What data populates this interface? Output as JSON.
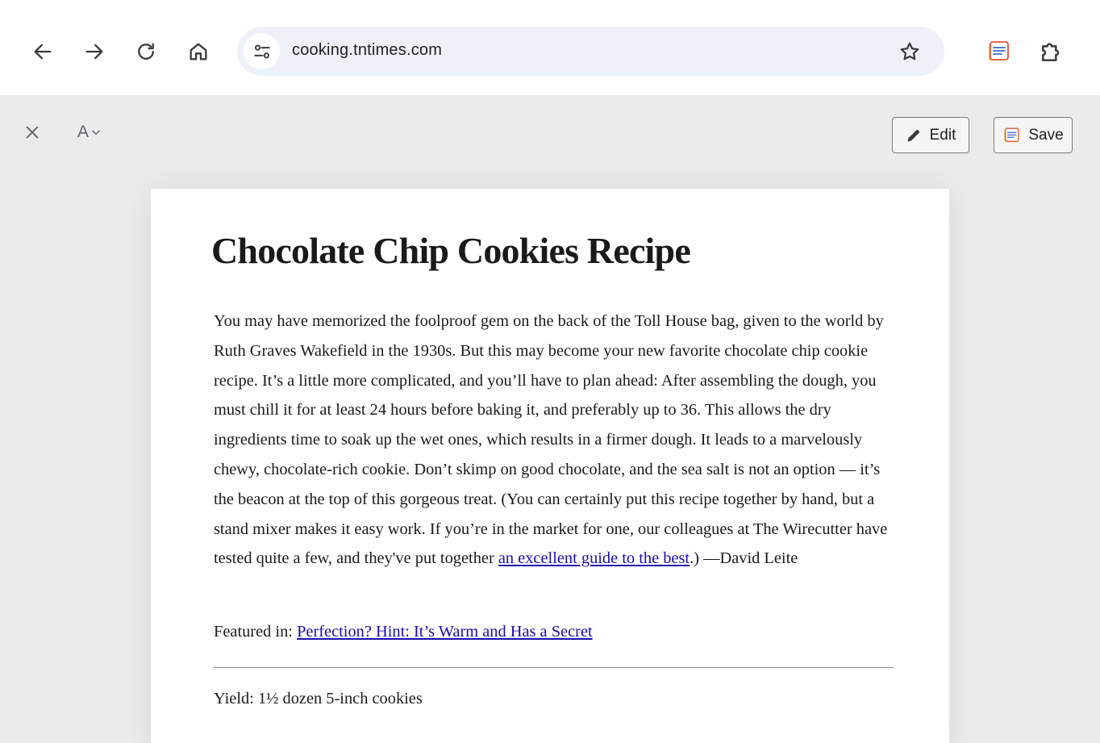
{
  "browser": {
    "url": "cooking.tntimes.com",
    "icons": {
      "back": "arrow-left-icon",
      "forward": "arrow-right-icon",
      "reload": "reload-icon",
      "home": "home-icon",
      "site_info": "tune-icon",
      "bookmark": "star-icon",
      "notes_extension": "notes-icon",
      "extensions": "puzzle-piece-icon"
    }
  },
  "reader_bar": {
    "font_label": "A",
    "edit_label": "Edit",
    "save_label": "Save"
  },
  "article": {
    "title": "Chocolate Chip Cookies Recipe",
    "intro": "You may have memorized the foolproof gem on the back of the Toll House bag, given to the world by Ruth Graves Wakefield in the 1930s. But this may become your new favorite chocolate chip cookie recipe. It’s a little more complicated, and you’ll have to plan ahead: After assembling the dough, you must chill it for at least 24 hours before baking it, and preferably up to 36. This allows the dry ingredients time to soak up the wet ones, which results in a firmer dough. It leads to a marvelously chewy, chocolate-rich cookie. Don’t skimp on good chocolate, and the sea salt is not an option — it’s the beacon at the top of this gorgeous treat. (You can certainly put this recipe together by hand, but a stand mixer makes it easy work. If you’re in the market for one, our colleagues at The Wirecutter have tested quite a few, and they've put together ",
    "guide_link": "an excellent guide to the best",
    "intro_end": ".) —David Leite",
    "featured_label": "Featured in: ",
    "featured_link": "Perfection? Hint: It’s Warm and Has a Secret",
    "yield": "Yield: 1½ dozen 5-inch cookies"
  },
  "colors": {
    "link": "#1a0dab",
    "omnibox_bg": "#eef2f8",
    "reader_bg": "#ebebeb"
  }
}
